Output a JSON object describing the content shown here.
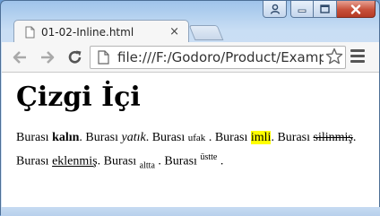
{
  "browser": {
    "tab_title": "01-02-Inline.html",
    "tab_close": "×",
    "url": "file:///F:/Godoro/Product/Exampl"
  },
  "page": {
    "heading": "Çizgi İçi",
    "paragraph": {
      "w1": "Burası ",
      "bold": "kalın",
      "w2": ". Burası ",
      "italic": "yatık",
      "w3": ". Burası ",
      "small": "ufak",
      "w4": " . Burası ",
      "highlight": "imli",
      "w5": ". Burası ",
      "deleted": "silinmiş",
      "w6": ". Burası ",
      "inserted": "eklenmiş",
      "w7": ". Burası ",
      "sub": "altta",
      "w8": " . Burası ",
      "sup": "üstte",
      "w9": " ."
    }
  },
  "colors": {
    "highlight": "#ffff00",
    "close_button": "#c7503a",
    "frame": "#c9def4"
  },
  "icons": {
    "user": "user-icon",
    "minimize": "minimize-icon",
    "maximize": "maximize-icon",
    "close": "close-icon",
    "back": "back-arrow-icon",
    "forward": "forward-arrow-icon",
    "reload": "reload-icon",
    "page": "page-icon",
    "star": "star-icon",
    "menu": "menu-icon"
  }
}
